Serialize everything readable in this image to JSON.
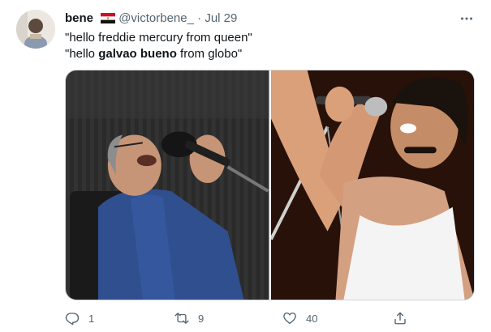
{
  "tweet": {
    "author": {
      "name": "bene",
      "handle": "@victorbene_",
      "separator": "·",
      "date": "Jul 29"
    },
    "lines": [
      {
        "before": "\"hello freddie mercury from queen\"",
        "bold": "",
        "after": ""
      },
      {
        "before": "\"hello ",
        "bold": "galvao bueno",
        "after": " from globo\""
      }
    ],
    "media": [
      {
        "name": "galvao-bueno-photo"
      },
      {
        "name": "freddie-mercury-photo"
      }
    ],
    "actions": {
      "reply_count": "1",
      "retweet_count": "9",
      "like_count": "40",
      "share_count": ""
    }
  },
  "icons": {
    "flag": "egypt-flag-icon",
    "more": "more-icon",
    "reply": "reply-icon",
    "retweet": "retweet-icon",
    "like": "heart-icon",
    "share": "share-icon"
  },
  "colors": {
    "text_primary": "#0f1419",
    "text_secondary": "#536471",
    "border": "#cfd9de"
  }
}
